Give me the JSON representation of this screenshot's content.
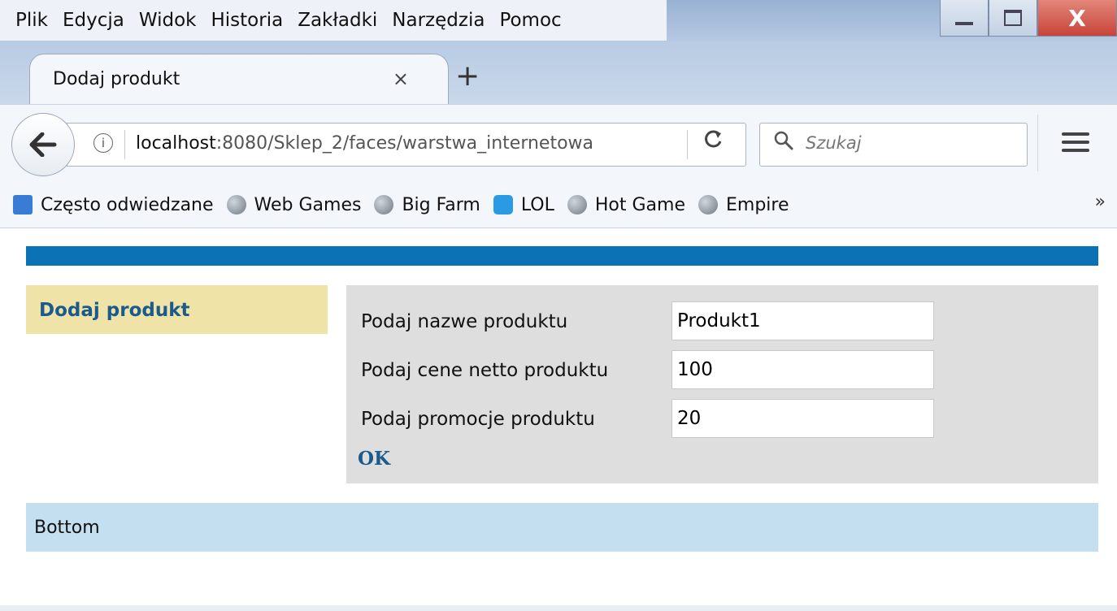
{
  "menu": {
    "items": [
      {
        "label": "Plik"
      },
      {
        "label": "Edycja"
      },
      {
        "label": "Widok"
      },
      {
        "label": "Historia"
      },
      {
        "label": "Zakładki"
      },
      {
        "label": "Narzędzia"
      },
      {
        "label": "Pomoc"
      }
    ]
  },
  "window_buttons": {
    "minimize_icon": "minimize-icon",
    "maximize_icon": "maximize-icon",
    "close_label": "X"
  },
  "tab": {
    "title": "Dodaj produkt",
    "close_glyph": "×",
    "new_tab_glyph": "+"
  },
  "navbar": {
    "back_icon": "arrow-left-icon",
    "info_glyph": "i",
    "url_host": "localhost",
    "url_path": ":8080/Sklep_2/faces/warstwa_internetowa",
    "reload_glyph": "C",
    "search_placeholder": "Szukaj"
  },
  "bookmarks": {
    "items": [
      {
        "label": "Często odwiedzane",
        "icon": "blue-square-icon"
      },
      {
        "label": "Web Games",
        "icon": "globe-icon"
      },
      {
        "label": "Big Farm",
        "icon": "globe-icon"
      },
      {
        "label": "LOL",
        "icon": "lol-icon"
      },
      {
        "label": "Hot Game",
        "icon": "globe-icon"
      },
      {
        "label": "Empire",
        "icon": "globe-icon"
      }
    ],
    "overflow_glyph": "»"
  },
  "page": {
    "top_strip_color": "#0b72b5",
    "left_link": "Dodaj produkt",
    "form": {
      "rows": [
        {
          "label": "Podaj nazwe produktu",
          "value": "Produkt1"
        },
        {
          "label": "Podaj cene netto produktu",
          "value": "100"
        },
        {
          "label": "Podaj promocje produktu",
          "value": "20"
        }
      ],
      "submit_label": "OK"
    },
    "bottom_text": "Bottom"
  }
}
